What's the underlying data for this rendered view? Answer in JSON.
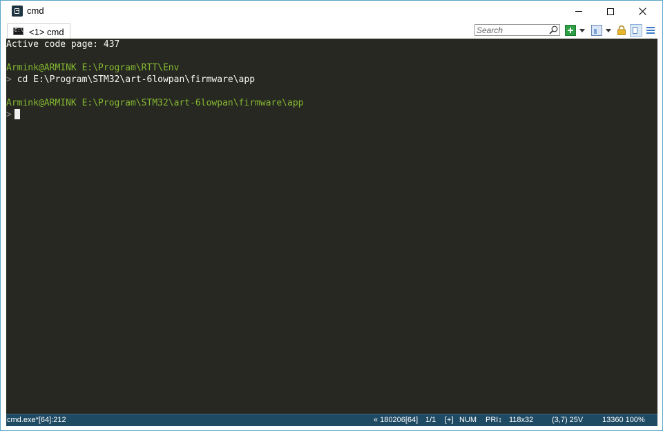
{
  "window": {
    "title": "cmd"
  },
  "tab": {
    "icon_text": "C:\\",
    "label": "<1> cmd"
  },
  "toolbar": {
    "search_placeholder": "Search"
  },
  "console": {
    "lines": [
      {
        "text": "Active code page: 437",
        "style": "normal"
      },
      {
        "text": "",
        "style": "normal"
      },
      {
        "text": "Armink@ARMINK E:\\Program\\RTT\\Env",
        "style": "green"
      },
      {
        "text": "cd E:\\Program\\STM32\\art-6lowpan\\firmware\\app",
        "style": "command"
      },
      {
        "text": "",
        "style": "normal"
      },
      {
        "text": "Armink@ARMINK E:\\Program\\STM32\\art-6lowpan\\firmware\\app",
        "style": "green"
      },
      {
        "text": "",
        "style": "cursor"
      }
    ],
    "prompt_symbol": ">"
  },
  "statusbar": {
    "process": "cmd.exe*[64]:212",
    "build": "« 180206[64]",
    "console_index": "1/1",
    "flags": "[+]",
    "numlock": "NUM",
    "priority": "PRI↕",
    "size": "118x32",
    "cursor_pos": "(3,7) 25V",
    "pid_zoom": "13360  100%"
  },
  "colors": {
    "console_bg": "#272822",
    "console_fg": "#f8f8f2",
    "prompt_green": "#84b830",
    "status_bg": "#1f4a63"
  }
}
